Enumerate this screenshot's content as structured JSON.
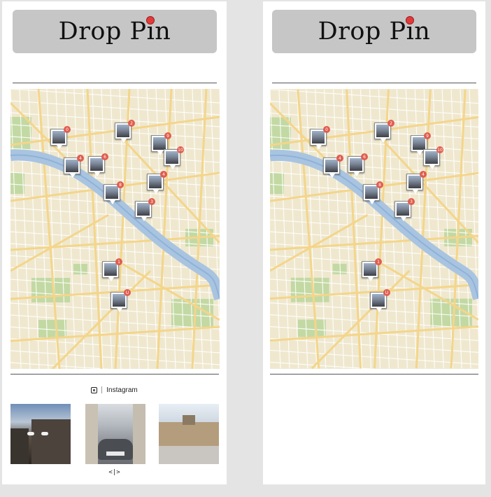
{
  "app": {
    "logo_prefix": "Drop P",
    "logo_i": "i",
    "logo_suffix": "n"
  },
  "markers": [
    {
      "badge": "0"
    },
    {
      "badge": "2"
    },
    {
      "badge": "9"
    },
    {
      "badge": "10"
    },
    {
      "badge": "6"
    },
    {
      "badge": "4"
    },
    {
      "badge": "8"
    },
    {
      "badge": "4"
    },
    {
      "badge": "3"
    },
    {
      "badge": "1"
    },
    {
      "badge": "U"
    }
  ],
  "instagram": {
    "label": "Instagram"
  },
  "gallery": {
    "pager": "<|>"
  },
  "colors": {
    "logo_bg": "#c6c6c6",
    "pin_red": "#e03b3b",
    "badge_red": "#e05c4f",
    "river": "#a9c4e0",
    "park": "#c3d9a4",
    "road": "#f4d58a"
  }
}
